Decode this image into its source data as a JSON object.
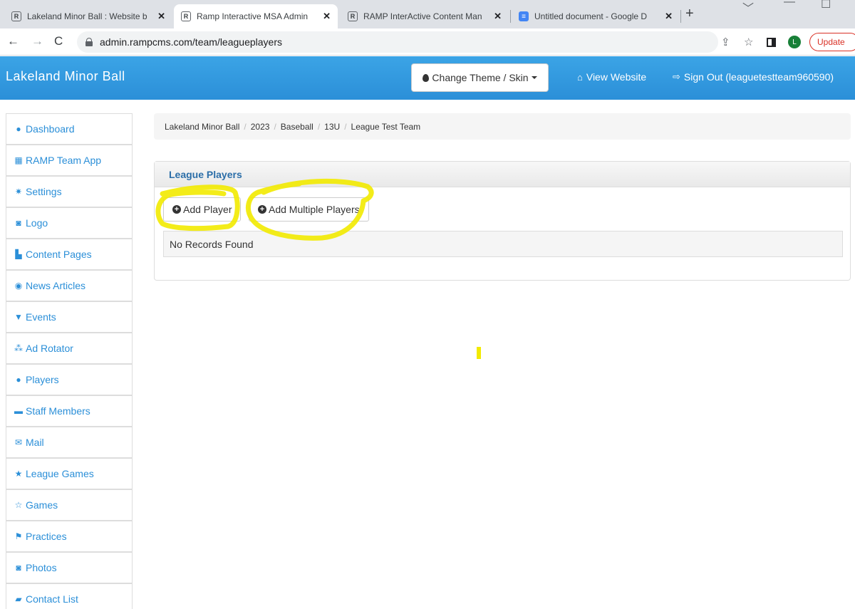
{
  "browser": {
    "tabs": [
      {
        "title": "Lakeland Minor Ball : Website b",
        "favicon": "R",
        "active": false
      },
      {
        "title": "Ramp Interactive MSA Admin",
        "favicon": "R",
        "active": true
      },
      {
        "title": "RAMP InterActive Content Man",
        "favicon": "R",
        "active": false
      },
      {
        "title": "Untitled document - Google D",
        "favicon": "doc-icon",
        "active": false
      }
    ],
    "new_tab": "+",
    "url": "admin.rampcms.com/team/leagueplayers",
    "profile_initial": "L",
    "update_label": "Update"
  },
  "header": {
    "brand": "Lakeland Minor Ball",
    "theme_button": "Change Theme / Skin",
    "view_website": "View Website",
    "sign_out": "Sign Out (leaguetestteam960590)",
    "background_color": "#2b8fd8"
  },
  "sidebar": {
    "items": [
      {
        "label": "Dashboard",
        "icon": "user-icon"
      },
      {
        "label": "RAMP Team App",
        "icon": "grid-icon"
      },
      {
        "label": "Settings",
        "icon": "gear-icon"
      },
      {
        "label": "Logo",
        "icon": "camera-icon"
      },
      {
        "label": "Content Pages",
        "icon": "file-icon"
      },
      {
        "label": "News Articles",
        "icon": "globe-icon"
      },
      {
        "label": "Events",
        "icon": "glass-icon"
      },
      {
        "label": "Ad Rotator",
        "icon": "ad-icon"
      },
      {
        "label": "Players",
        "icon": "user-icon"
      },
      {
        "label": "Staff Members",
        "icon": "briefcase-icon"
      },
      {
        "label": "Mail",
        "icon": "envelope-icon"
      },
      {
        "label": "League Games",
        "icon": "star-icon"
      },
      {
        "label": "Games",
        "icon": "star-outline-icon"
      },
      {
        "label": "Practices",
        "icon": "flag-icon"
      },
      {
        "label": "Photos",
        "icon": "camera-icon"
      },
      {
        "label": "Contact List",
        "icon": "comment-icon"
      }
    ]
  },
  "breadcrumb": [
    "Lakeland Minor Ball",
    "2023",
    "Baseball",
    "13U",
    "League Test Team"
  ],
  "panel": {
    "title": "League Players",
    "add_player": "Add Player",
    "add_multiple": "Add Multiple Players",
    "empty_message": "No Records Found"
  }
}
